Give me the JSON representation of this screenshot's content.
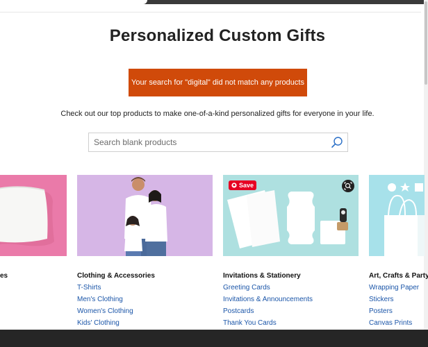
{
  "page": {
    "title": "Personalized Custom Gifts",
    "alert": "Your search for \"digital\" did not match any products",
    "intro": "Check out our top products to make one-of-a-kind personalized gifts for everyone in your life."
  },
  "search": {
    "placeholder": "Search blank products",
    "value": ""
  },
  "overlay": {
    "save_label": "Save"
  },
  "categories": [
    {
      "title": "es",
      "links": []
    },
    {
      "title": "Clothing & Accessories",
      "links": [
        "T-Shirts",
        "Men's Clothing",
        "Women's Clothing",
        "Kids' Clothing"
      ]
    },
    {
      "title": "Invitations & Stationery",
      "links": [
        "Greeting Cards",
        "Invitations & Announcements",
        "Postcards",
        "Thank You Cards"
      ]
    },
    {
      "title": "Art, Crafts & Party",
      "links": [
        "Wrapping Paper",
        "Stickers",
        "Posters",
        "Canvas Prints"
      ]
    }
  ],
  "colors": {
    "alert_bg": "#d04a0a",
    "link": "#1a55a8",
    "pillow_bg": "#ea7aa9",
    "clothing_bg": "#d6b6e6",
    "stationery_bg": "#aee0e0",
    "crafts_bg": "#a7e1ea",
    "pinterest_red": "#e60023"
  }
}
